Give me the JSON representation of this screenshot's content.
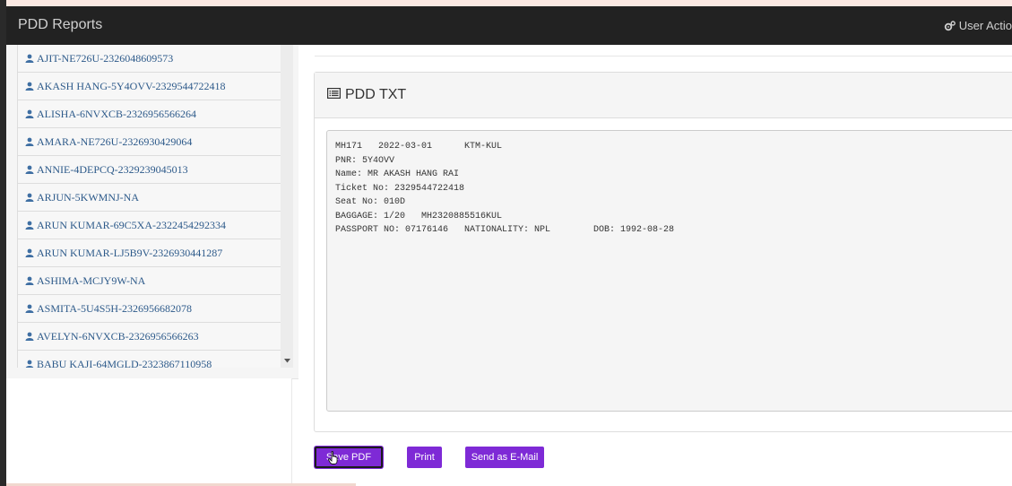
{
  "navbar": {
    "brand": "PDD Reports",
    "user_action": "User Actio",
    "user_action_icon": "gears-icon"
  },
  "sidebar": {
    "items": [
      {
        "label": "AJIT-NE726U-2326048609573"
      },
      {
        "label": "AKASH HANG-5Y4OVV-2329544722418"
      },
      {
        "label": "ALISHA-6NVXCB-2326956566264"
      },
      {
        "label": "AMARA-NE726U-2326930429064"
      },
      {
        "label": "ANNIE-4DEPCQ-2329239045013"
      },
      {
        "label": "ARJUN-5KWMNJ-NA"
      },
      {
        "label": "ARUN KUMAR-69C5XA-2322454292334"
      },
      {
        "label": "ARUN KUMAR-LJ5B9V-2326930441287"
      },
      {
        "label": "ASHIMA-MCJY9W-NA"
      },
      {
        "label": "ASMITA-5U4S5H-2326956682078"
      },
      {
        "label": "AVELYN-6NVXCB-2326956566263"
      },
      {
        "label": "BABU KAJI-64MGLD-2323867110958"
      }
    ],
    "item_icon": "user-icon"
  },
  "panel": {
    "title": "PDD TXT",
    "title_icon": "list-alt-icon",
    "lines": [
      "MH171   2022-03-01      KTM-KUL",
      "PNR: 5Y4OVV",
      "Name: MR AKASH HANG RAI",
      "Ticket No: 2329544722418",
      "Seat No: 010D",
      "BAGGAGE: 1/20   MH2320885516KUL",
      "PASSPORT NO: 07176146   NATIONALITY: NPL        DOB: 1992-08-28"
    ]
  },
  "buttons": {
    "save_pdf": "Save PDF",
    "print": "Print",
    "email": "Send as E-Mail"
  },
  "colors": {
    "navbar_bg": "#222222",
    "button_bg": "#7e2ad6",
    "link": "#2d5a8a"
  }
}
